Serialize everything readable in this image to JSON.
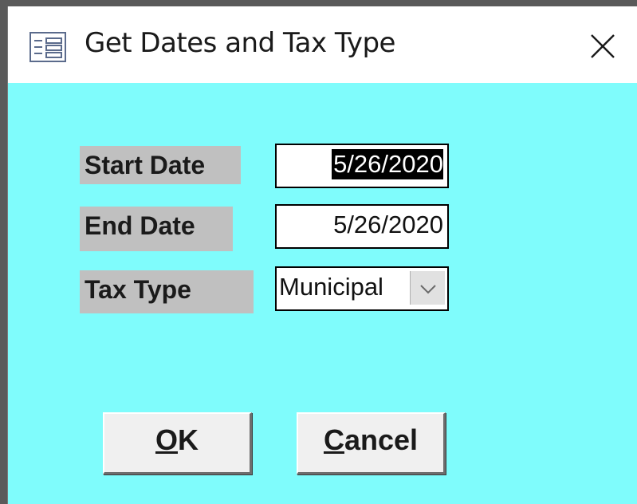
{
  "window": {
    "title": "Get Dates and Tax Type",
    "icon": "form-icon",
    "close_icon": "close-icon",
    "client_background": "#7ffcfc"
  },
  "form": {
    "start_date": {
      "label": "Start Date",
      "value": "5/26/2020",
      "selected": true
    },
    "end_date": {
      "label": "End Date",
      "value": "5/26/2020"
    },
    "tax_type": {
      "label": "Tax Type",
      "value": "Municipal",
      "dropdown_icon": "chevron-down-icon"
    }
  },
  "buttons": {
    "ok_label": "OK",
    "cancel_label": "Cancel"
  }
}
